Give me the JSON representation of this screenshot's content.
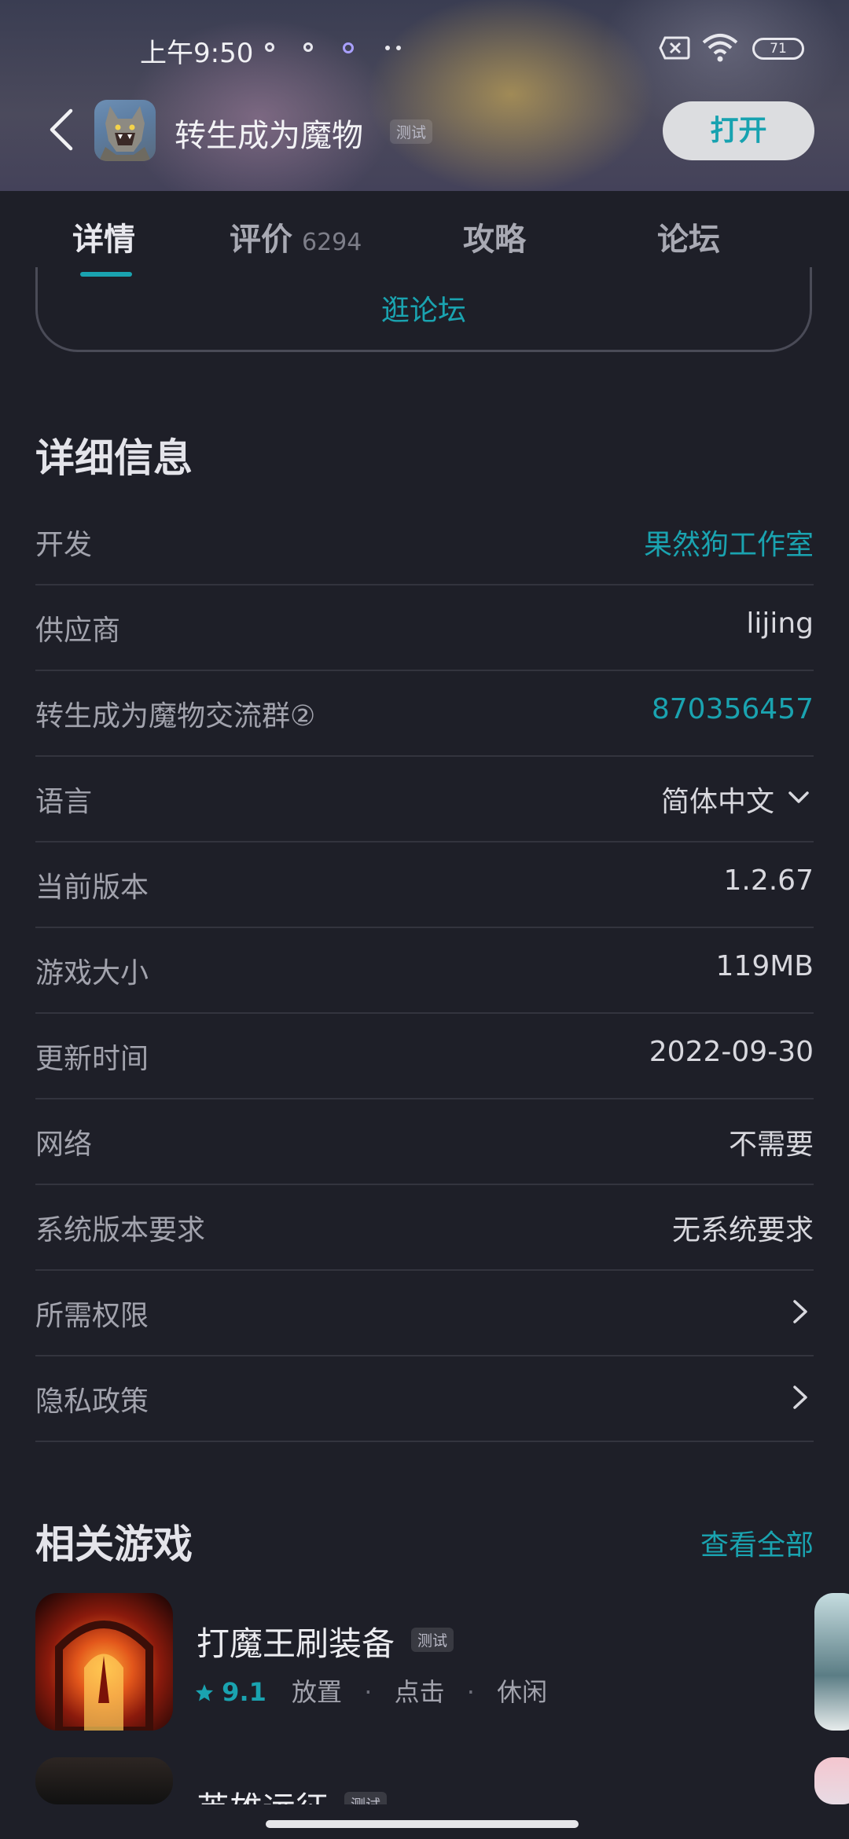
{
  "status_bar": {
    "time": "上午9:50",
    "battery": "71"
  },
  "header": {
    "app_title": "转生成为魔物",
    "title_tag": "测试",
    "open_label": "打开"
  },
  "tabs": [
    {
      "label": "详情",
      "count": ""
    },
    {
      "label": "评价",
      "count": "6294"
    },
    {
      "label": "攻略",
      "count": ""
    },
    {
      "label": "论坛",
      "count": ""
    }
  ],
  "forum_button": "逛论坛",
  "details": {
    "title": "详细信息",
    "rows": [
      {
        "label": "开发",
        "value": "果然狗工作室"
      },
      {
        "label": "供应商",
        "value": "lijing"
      },
      {
        "label": "转生成为魔物交流群②",
        "value": "870356457"
      },
      {
        "label": "语言",
        "value": "简体中文"
      },
      {
        "label": "当前版本",
        "value": "1.2.67"
      },
      {
        "label": "游戏大小",
        "value": "119MB"
      },
      {
        "label": "更新时间",
        "value": "2022-09-30"
      },
      {
        "label": "网络",
        "value": "不需要"
      },
      {
        "label": "系统版本要求",
        "value": "无系统要求"
      },
      {
        "label": "所需权限",
        "value": ""
      },
      {
        "label": "隐私政策",
        "value": ""
      }
    ]
  },
  "related": {
    "title": "相关游戏",
    "see_all": "查看全部",
    "games": [
      {
        "name": "打魔王刷装备",
        "tag": "测试",
        "rating": "9.1",
        "tags": [
          "放置",
          "点击",
          "休闲"
        ]
      },
      {
        "name": "英雄远征",
        "tag": "测试"
      }
    ]
  },
  "colors": {
    "accent": "#1aa3b0",
    "background": "#1e1f28"
  }
}
